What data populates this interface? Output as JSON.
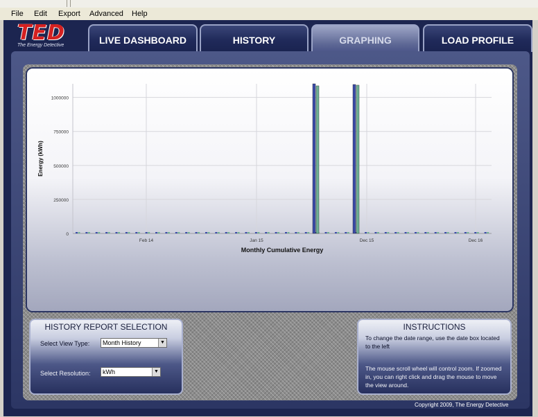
{
  "menu": {
    "items": [
      "File",
      "Edit",
      "Export",
      "Advanced",
      "Help"
    ]
  },
  "logo": {
    "brand": "TED",
    "tagline": "The Energy Detective"
  },
  "tabs": [
    {
      "label": "LIVE DASHBOARD",
      "active": false
    },
    {
      "label": "HISTORY",
      "active": false
    },
    {
      "label": "GRAPHING",
      "active": true
    },
    {
      "label": "LOAD PROFILE",
      "active": false
    }
  ],
  "chart_data": {
    "type": "bar",
    "title": "",
    "xlabel": "Monthly Cumulative Energy",
    "ylabel": "Energy (kWh)",
    "ylim": [
      0,
      1100000
    ],
    "yticks": [
      0,
      250000,
      500000,
      750000,
      1000000
    ],
    "ytick_labels": [
      "0",
      "250000",
      "500000",
      "750000",
      "1000000"
    ],
    "xtick_labels": [
      "Feb 14",
      "Jan 15",
      "Dec 15",
      "Dec 16"
    ],
    "grid": true,
    "series_colors": [
      "#3a4aa8",
      "#6fb095"
    ],
    "num_months": 42,
    "spikes": [
      {
        "month_index": 24,
        "values": [
          1100000,
          1085000
        ]
      },
      {
        "month_index": 28,
        "values": [
          1095000,
          1090000
        ]
      }
    ],
    "baseline_value": 0
  },
  "history_panel": {
    "title": "HISTORY REPORT SELECTION",
    "view_type_label": "Select View Type:",
    "view_type_value": "Month History",
    "resolution_label": "Select Resolution:",
    "resolution_value": "kWh"
  },
  "instructions": {
    "title": "INSTRUCTIONS",
    "text1": "To change the date range, use the date box located to the left",
    "text2": "The mouse scroll wheel will control zoom. If zoomed in, you can right click and drag the mouse to move the view around."
  },
  "footer": {
    "copyright": "Copyright 2009, The Energy Detective"
  },
  "colors": {
    "frame": "#1c2550",
    "accent": "#9aa3c6"
  }
}
